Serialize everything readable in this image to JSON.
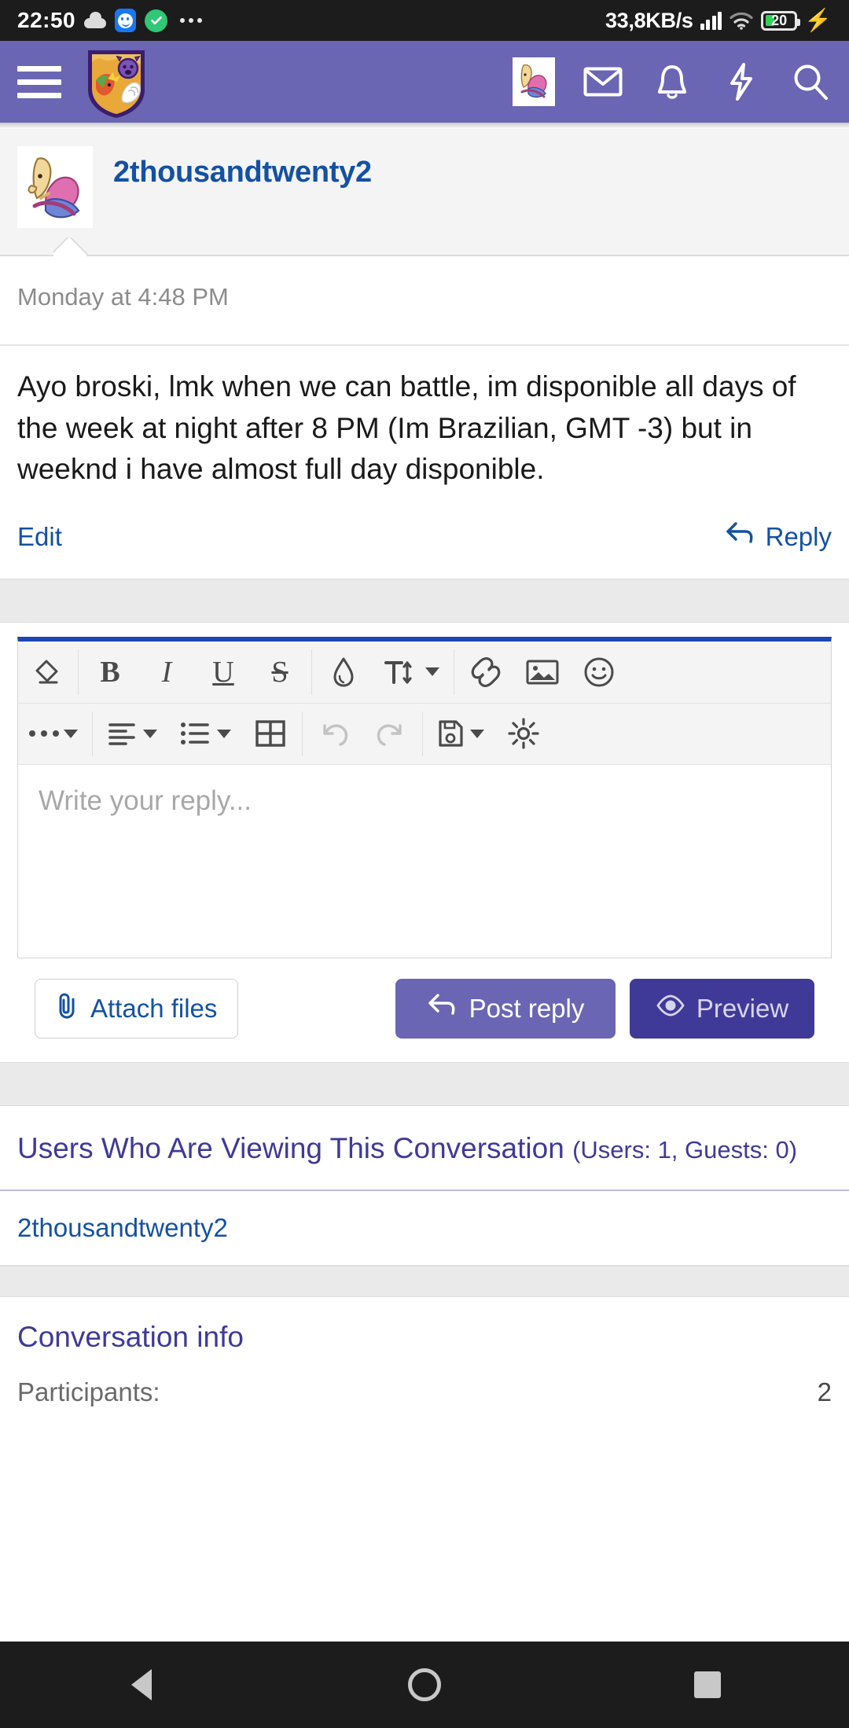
{
  "statusbar": {
    "time": "22:50",
    "network_speed": "33,8KB/s",
    "battery_percent": "20",
    "icons": [
      "cloud-icon",
      "smiley-icon",
      "check-circle-icon",
      "overflow-dots-icon",
      "signal-icon",
      "wifi-icon",
      "battery-icon",
      "charging-bolt-icon"
    ]
  },
  "appbar": {
    "menu_label": "hamburger-menu",
    "logo_label": "forum-logo",
    "actions": [
      {
        "name": "user-avatar-button",
        "label": "account"
      },
      {
        "name": "inbox-button",
        "label": "inbox"
      },
      {
        "name": "alerts-button",
        "label": "alerts"
      },
      {
        "name": "whats-new-button",
        "label": "what's new"
      },
      {
        "name": "search-button",
        "label": "search"
      }
    ]
  },
  "post": {
    "username": "2thousandtwenty2",
    "date": "Monday at 4:48 PM",
    "body": "Ayo broski, lmk when we can battle, im disponible all days of the week at night after 8 PM (Im Brazilian, GMT -3) but in weeknd i have almost full day disponible.",
    "edit_label": "Edit",
    "reply_label": "Reply"
  },
  "editor": {
    "placeholder": "Write your reply...",
    "toolbar_row1": [
      {
        "name": "remove-formatting-icon",
        "glyph": "eraser"
      },
      {
        "name": "bold-icon",
        "glyph": "B"
      },
      {
        "name": "italic-icon",
        "glyph": "I"
      },
      {
        "name": "underline-icon",
        "glyph": "U"
      },
      {
        "name": "strikethrough-icon",
        "glyph": "S"
      },
      {
        "name": "text-color-icon",
        "glyph": "droplet"
      },
      {
        "name": "font-size-icon",
        "glyph": "T-size"
      },
      {
        "name": "insert-link-icon",
        "glyph": "link"
      },
      {
        "name": "insert-image-icon",
        "glyph": "image"
      },
      {
        "name": "smilies-icon",
        "glyph": "smiley"
      }
    ],
    "toolbar_row2": [
      {
        "name": "more-options-icon",
        "glyph": "dots"
      },
      {
        "name": "text-align-icon",
        "glyph": "align"
      },
      {
        "name": "list-icon",
        "glyph": "list"
      },
      {
        "name": "insert-table-icon",
        "glyph": "table"
      },
      {
        "name": "undo-icon",
        "glyph": "undo"
      },
      {
        "name": "redo-icon",
        "glyph": "redo"
      },
      {
        "name": "drafts-icon",
        "glyph": "floppy"
      },
      {
        "name": "editor-settings-icon",
        "glyph": "gear"
      }
    ],
    "attach_label": "Attach files",
    "post_label": "Post reply",
    "preview_label": "Preview"
  },
  "viewers": {
    "title": "Users Who Are Viewing This Conversation",
    "counts": "(Users: 1, Guests: 0)",
    "list": [
      "2thousandtwenty2"
    ]
  },
  "conversation_info": {
    "title": "Conversation info",
    "participants_label": "Participants:",
    "participants_value": "2"
  },
  "navbar": {
    "back_label": "back",
    "home_label": "home",
    "recents_label": "recents"
  },
  "colors": {
    "brand_purple": "#6a66b3",
    "dark_purple": "#3f3a97",
    "link_blue": "#1451a3",
    "editor_accent": "#1a46b8"
  }
}
